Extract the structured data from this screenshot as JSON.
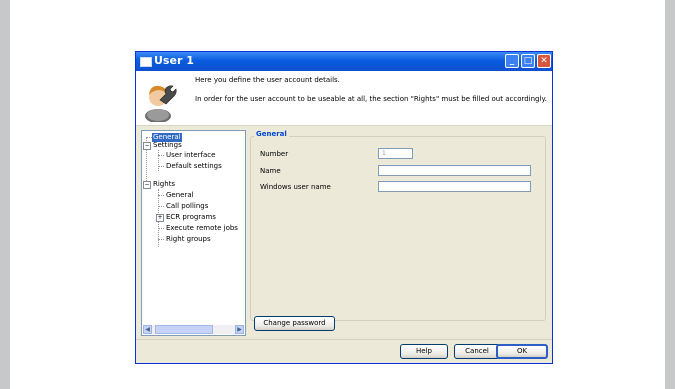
{
  "window": {
    "title": "User 1",
    "buttons": {
      "minimize": "_",
      "maximize": "□",
      "close": "✕"
    }
  },
  "header": {
    "line1": "Here you define the user account details.",
    "line2": "In order for the user account to be useable at all, the section \"Rights\" must be filled out accordingly.",
    "icon": "user-wrench-icon"
  },
  "tree": {
    "general": "General",
    "settings": "Settings",
    "user_interface": "User interface",
    "default_settings": "Default settings",
    "rights": "Rights",
    "rights_general": "General",
    "call_pollings": "Call pollings",
    "ecr_programs": "ECR programs",
    "execute_remote_jobs": "Execute remote jobs",
    "right_groups": "Right groups",
    "expanded_glyph": "−",
    "collapsed_glyph": "+"
  },
  "form": {
    "group_title": "General",
    "number_label": "Number",
    "number_value": "1",
    "name_label": "Name",
    "name_value": "",
    "windows_user_label": "Windows user name",
    "windows_user_value": ""
  },
  "buttons": {
    "change_password": "Change password",
    "help": "Help",
    "cancel": "Cancel",
    "ok": "OK"
  },
  "colors": {
    "titlebar": "#0a5be0",
    "selection": "#316ac5",
    "group_title": "#0046d5"
  }
}
